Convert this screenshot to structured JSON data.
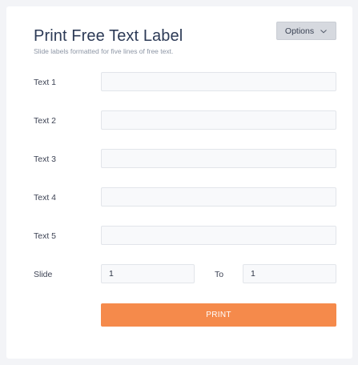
{
  "header": {
    "title": "Print Free Text Label",
    "subtitle": "Slide labels formatted for five lines of free text.",
    "options_label": "Options"
  },
  "fields": [
    {
      "label": "Text 1",
      "value": ""
    },
    {
      "label": "Text 2",
      "value": ""
    },
    {
      "label": "Text 3",
      "value": ""
    },
    {
      "label": "Text 4",
      "value": ""
    },
    {
      "label": "Text 5",
      "value": ""
    }
  ],
  "slide": {
    "label": "Slide",
    "from_value": "1",
    "to_label": "To",
    "to_value": "1"
  },
  "print_label": "PRINT",
  "colors": {
    "accent": "#f58a4b",
    "background": "#f3f4f7",
    "card": "#ffffff"
  }
}
